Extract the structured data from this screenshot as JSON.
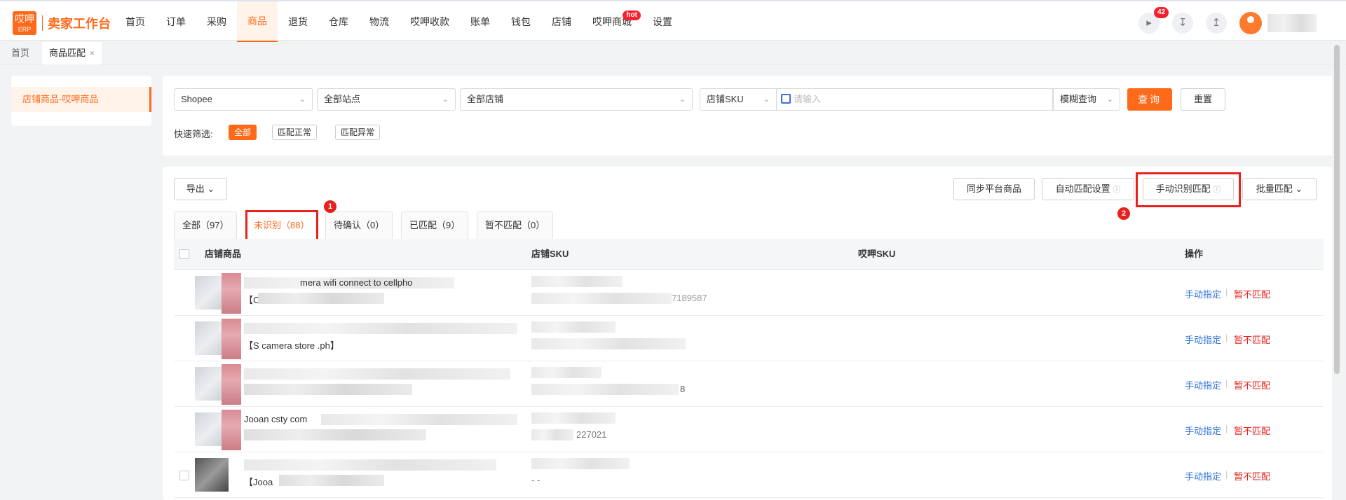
{
  "app": {
    "logo_top": "哎呷",
    "logo_bottom": "ERP",
    "title": "卖家工作台"
  },
  "nav": {
    "items": [
      "首页",
      "订单",
      "采购",
      "商品",
      "退货",
      "仓库",
      "物流",
      "哎呷收款",
      "账单",
      "钱包",
      "店铺",
      "哎呷商城",
      "设置"
    ],
    "active": "商品",
    "hot_label": "hot",
    "notification_count": "42"
  },
  "page_tabs": [
    {
      "label": "首页"
    },
    {
      "label": "商品匹配",
      "close": "×"
    }
  ],
  "side": {
    "item": "店铺商品-哎呷商品"
  },
  "filters": {
    "platform": "Shopee",
    "site": "全部站点",
    "shop": "全部店铺",
    "field": "店铺SKU",
    "keyword_placeholder": "请输入",
    "match_mode": "模糊查询",
    "query_label": "查询",
    "reset_label": "重置",
    "quick_label": "快速筛选:",
    "quick_chips": [
      "全部",
      "匹配正常",
      "匹配异常"
    ]
  },
  "toolbar": {
    "export_label": "导出",
    "sync_label": "同步平台商品",
    "auto_match_label": "自动匹配设置",
    "manual_identify_label": "手动识别匹配",
    "batch_label": "批量匹配"
  },
  "status_tabs": [
    {
      "label": "全部（97）"
    },
    {
      "label": "未识别（88）"
    },
    {
      "label": "待确认（0）"
    },
    {
      "label": "已匹配（9）"
    },
    {
      "label": "暂不匹配（0）"
    }
  ],
  "annotations": {
    "marker1": "1",
    "marker2": "2"
  },
  "table": {
    "headers": [
      "店铺商品",
      "店铺SKU",
      "哎呷SKU",
      "操作"
    ],
    "rows": [
      {
        "line1": "mera wifi connect to cellpho",
        "line2": "【C",
        "sku_tail": "7189587",
        "action_assign": "手动指定",
        "action_skip": "暂不匹配"
      },
      {
        "line1": "",
        "line2": "【S     camera store .ph】",
        "sku_tail": "",
        "action_assign": "手动指定",
        "action_skip": "暂不匹配"
      },
      {
        "line1": "",
        "line2": "",
        "sku_tail": "8",
        "action_assign": "手动指定",
        "action_skip": "暂不匹配"
      },
      {
        "line1": "Jooan csty com",
        "line2": "",
        "sku_tail": "227021",
        "action_assign": "手动指定",
        "action_skip": "暂不匹配"
      },
      {
        "line1": "",
        "line2": "【Jooa",
        "sku_tail": "- -",
        "action_assign": "手动指定",
        "action_skip": "暂不匹配"
      }
    ]
  }
}
